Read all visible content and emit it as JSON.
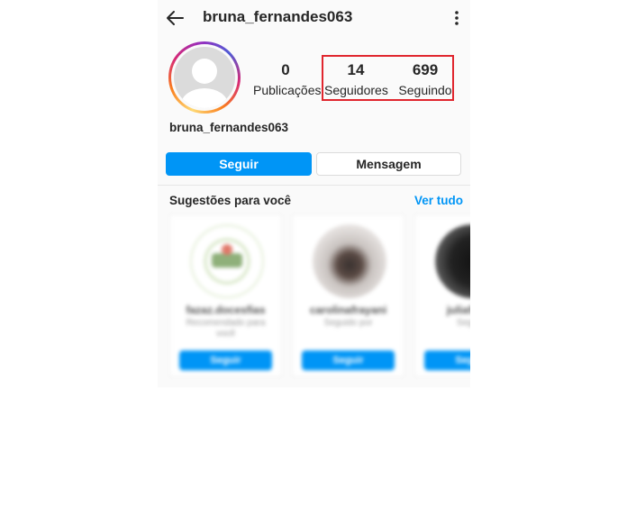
{
  "header": {
    "username": "bruna_fernandes063",
    "back_icon": "arrow-left-icon",
    "more_icon": "more-vertical-icon"
  },
  "profile": {
    "display_name": "bruna_fernandes063",
    "stats": {
      "posts": {
        "value": "0",
        "label": "Publicações"
      },
      "followers": {
        "value": "14",
        "label": "Seguidores"
      },
      "following": {
        "value": "699",
        "label": "Seguindo"
      }
    }
  },
  "actions": {
    "follow_label": "Seguir",
    "message_label": "Mensagem"
  },
  "suggestions": {
    "title": "Sugestões para você",
    "see_all_label": "Ver tudo",
    "cards": [
      {
        "name": "fazaz.docesfias",
        "subtitle": "Recomendado para você",
        "button": "Seguir"
      },
      {
        "name": "carolinafrayani",
        "subtitle": "Seguido por",
        "button": "Seguir"
      },
      {
        "name": "juliafrade",
        "subtitle": "Seguid",
        "button": "Seguir"
      }
    ]
  },
  "colors": {
    "accent_blue": "#0095f6",
    "highlight_red": "#e0262e",
    "background": "#fafafa"
  }
}
